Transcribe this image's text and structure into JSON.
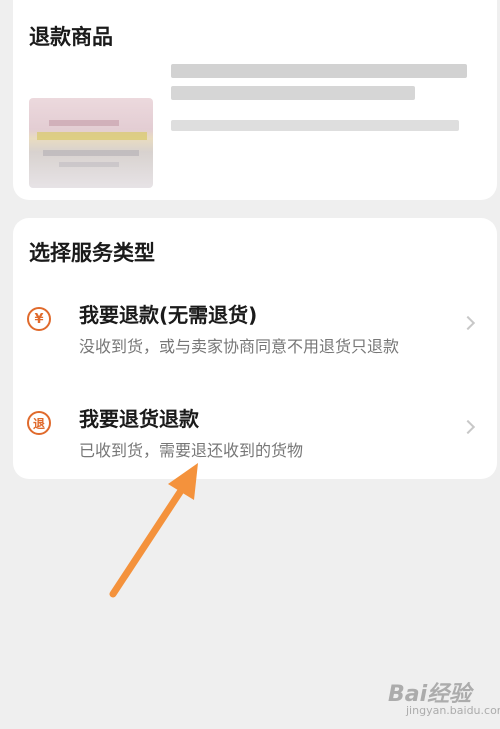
{
  "product_card": {
    "title": "退款商品"
  },
  "service_card": {
    "title": "选择服务类型",
    "options": [
      {
        "icon": "yen-refund-icon",
        "icon_glyph": "¥",
        "title": "我要退款(无需退货)",
        "subtitle": "没收到货，或与卖家协商同意不用退货只退款"
      },
      {
        "icon": "return-goods-icon",
        "icon_glyph": "退",
        "title": "我要退货退款",
        "subtitle": "已收到货，需要退还收到的货物"
      }
    ]
  },
  "watermark": {
    "text": "Bai经验",
    "sub": "jingyan.baidu.com"
  },
  "colors": {
    "accent": "#e06a2c",
    "arrow": "#f4923c",
    "background": "#efefef"
  }
}
